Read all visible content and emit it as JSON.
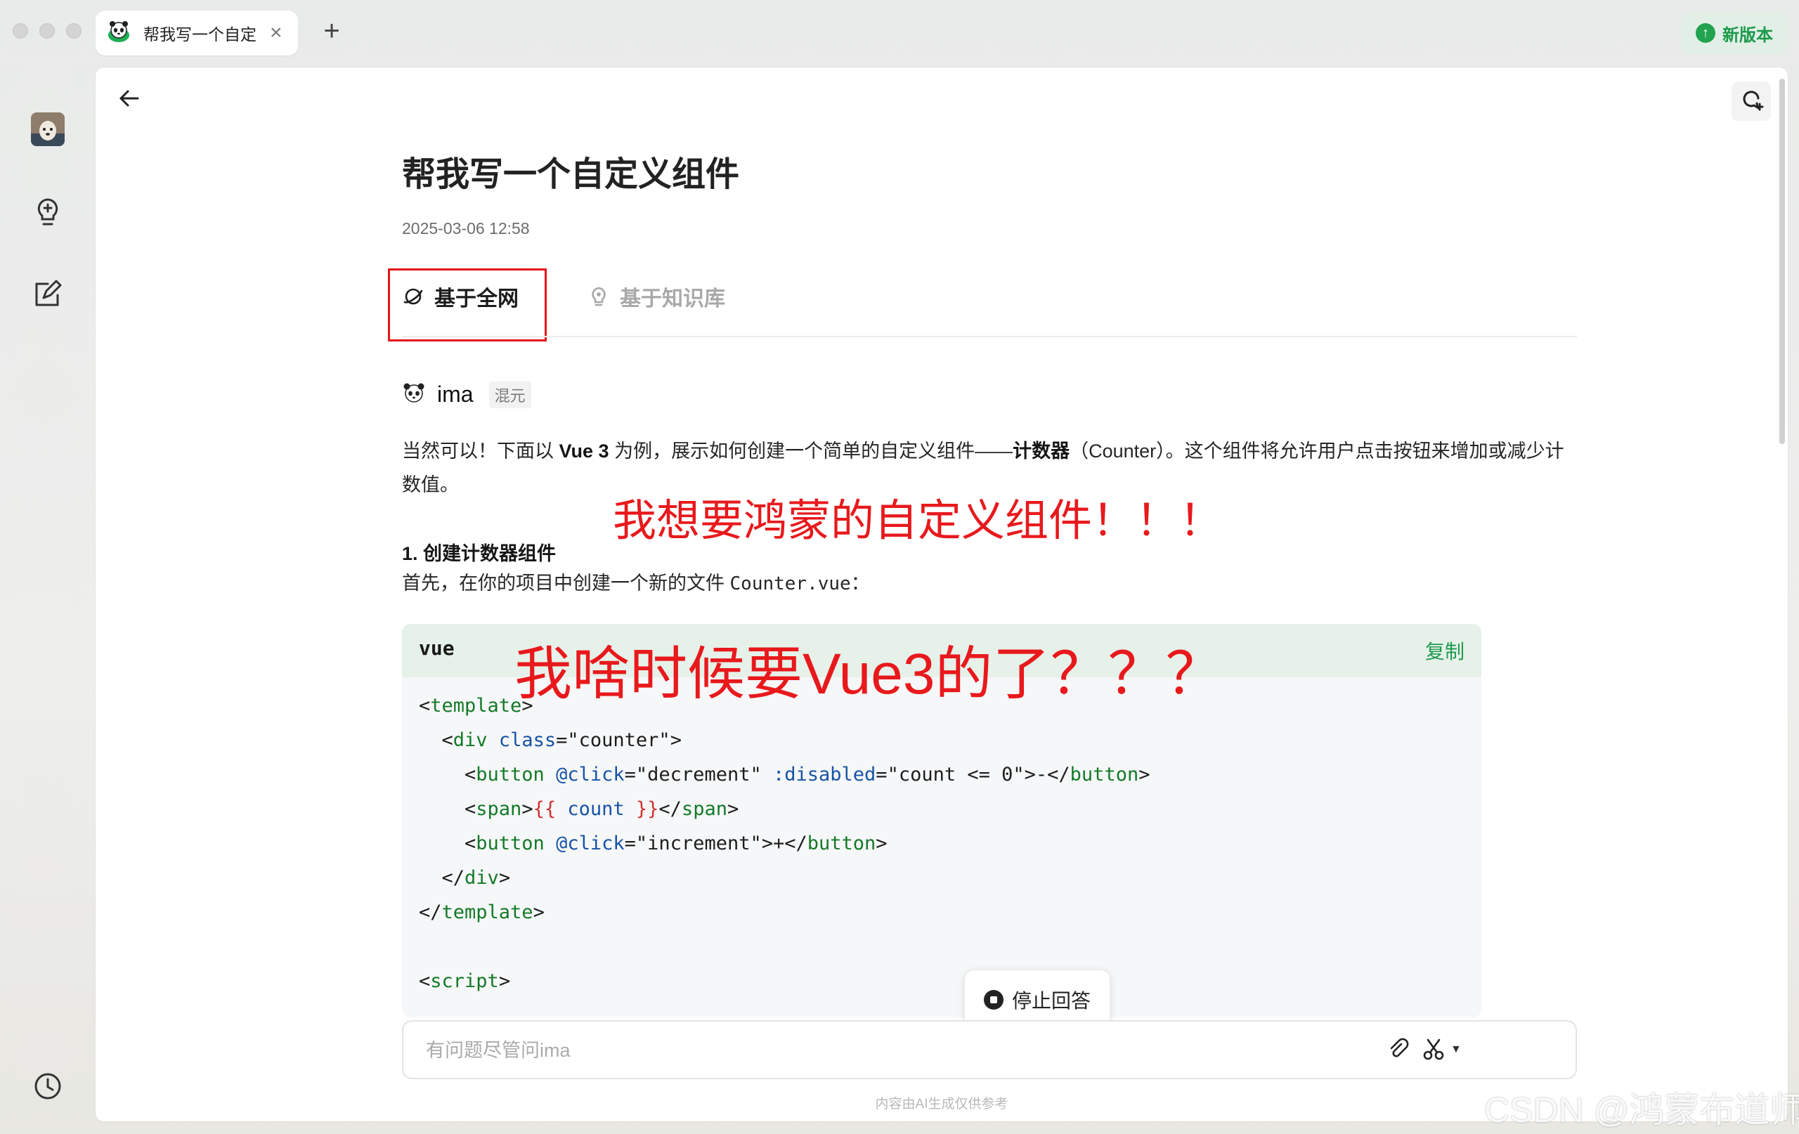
{
  "window": {
    "tab_title": "帮我写一个自定",
    "update_button": "新版本"
  },
  "conversation": {
    "title": "帮我写一个自定义组件",
    "timestamp": "2025-03-06 12:58",
    "tabs": [
      {
        "label": "基于全网",
        "active": true
      },
      {
        "label": "基于知识库",
        "active": false
      }
    ],
    "author": {
      "name": "ima",
      "model": "混元"
    },
    "intro_a": "当然可以！下面以 ",
    "intro_vue": "Vue 3",
    "intro_b": " 为例，展示如何创建一个简单的自定义组件——",
    "intro_counter": "计数器",
    "intro_c": "（Counter）。这个组件将允许用户点击按钮来增加或减少计数值。",
    "step1_heading": "1. 创建计数器组件",
    "step1_text_a": "首先，在你的项目中创建一个新的文件 ",
    "step1_file": "Counter.vue",
    "step1_text_b": "："
  },
  "code_block": {
    "language": "vue",
    "copy_label": "复制",
    "lines": [
      [
        [
          "tk-txt",
          "<"
        ],
        [
          "tk-tag",
          "template"
        ],
        [
          "tk-txt",
          ">"
        ]
      ],
      [
        [
          "tk-txt",
          "  <"
        ],
        [
          "tk-tag",
          "div"
        ],
        [
          "tk-txt",
          " "
        ],
        [
          "tk-attr",
          "class"
        ],
        [
          "tk-txt",
          "="
        ],
        [
          "tk-str",
          "\"counter\""
        ],
        [
          "tk-txt",
          ">"
        ]
      ],
      [
        [
          "tk-txt",
          "    <"
        ],
        [
          "tk-tag",
          "button"
        ],
        [
          "tk-txt",
          " "
        ],
        [
          "tk-attr",
          "@click"
        ],
        [
          "tk-txt",
          "="
        ],
        [
          "tk-str",
          "\"decrement\""
        ],
        [
          "tk-txt",
          " "
        ],
        [
          "tk-attr",
          ":disabled"
        ],
        [
          "tk-txt",
          "="
        ],
        [
          "tk-str",
          "\"count <= 0\""
        ],
        [
          "tk-txt",
          ">-</"
        ],
        [
          "tk-tag",
          "button"
        ],
        [
          "tk-txt",
          ">"
        ]
      ],
      [
        [
          "tk-txt",
          "    <"
        ],
        [
          "tk-tag",
          "span"
        ],
        [
          "tk-txt",
          ">"
        ],
        [
          "tk-mus",
          "{{"
        ],
        [
          "tk-txt",
          " "
        ],
        [
          "tk-attr",
          "count"
        ],
        [
          "tk-txt",
          " "
        ],
        [
          "tk-mus",
          "}}"
        ],
        [
          "tk-txt",
          "</"
        ],
        [
          "tk-tag",
          "span"
        ],
        [
          "tk-txt",
          ">"
        ]
      ],
      [
        [
          "tk-txt",
          "    <"
        ],
        [
          "tk-tag",
          "button"
        ],
        [
          "tk-txt",
          " "
        ],
        [
          "tk-attr",
          "@click"
        ],
        [
          "tk-txt",
          "="
        ],
        [
          "tk-str",
          "\"increment\""
        ],
        [
          "tk-txt",
          ">+</"
        ],
        [
          "tk-tag",
          "button"
        ],
        [
          "tk-txt",
          ">"
        ]
      ],
      [
        [
          "tk-txt",
          "  </"
        ],
        [
          "tk-tag",
          "div"
        ],
        [
          "tk-txt",
          ">"
        ]
      ],
      [
        [
          "tk-txt",
          "</"
        ],
        [
          "tk-tag",
          "template"
        ],
        [
          "tk-txt",
          ">"
        ]
      ],
      [
        [
          "tk-txt",
          ""
        ]
      ],
      [
        [
          "tk-txt",
          "<"
        ],
        [
          "tk-tag",
          "script"
        ],
        [
          "tk-txt",
          ">"
        ]
      ]
    ]
  },
  "stop_button": "停止回答",
  "input": {
    "placeholder": "有问题尽管问ima"
  },
  "disclaimer": "内容由AI生成仅供参考",
  "annotations": {
    "note1": "我想要鸿蒙的自定义组件！！！",
    "note2": "我啥时候要Vue3的了？？？"
  },
  "watermark": "CSDN @鸿蒙布道师",
  "colors": {
    "accent_green": "#1f9a4f",
    "annotation_red": "#e8191c",
    "code_header_bg": "#e6f1ea"
  }
}
